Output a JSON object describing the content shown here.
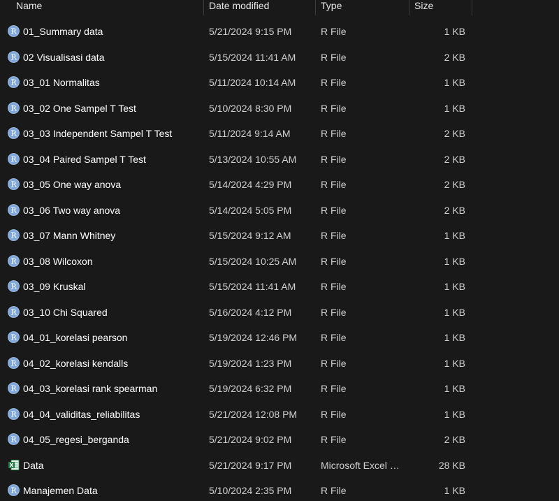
{
  "columns": {
    "name": "Name",
    "date": "Date modified",
    "type": "Type",
    "size": "Size"
  },
  "files": [
    {
      "icon": "r-file-icon",
      "name": "01_Summary data",
      "date": "5/21/2024 9:15 PM",
      "type": "R File",
      "size": "1 KB"
    },
    {
      "icon": "r-file-icon",
      "name": "02 Visualisasi data",
      "date": "5/15/2024 11:41 AM",
      "type": "R File",
      "size": "2 KB"
    },
    {
      "icon": "r-file-icon",
      "name": "03_01 Normalitas",
      "date": "5/11/2024 10:14 AM",
      "type": "R File",
      "size": "1 KB"
    },
    {
      "icon": "r-file-icon",
      "name": "03_02 One Sampel T Test",
      "date": "5/10/2024 8:30 PM",
      "type": "R File",
      "size": "1 KB"
    },
    {
      "icon": "r-file-icon",
      "name": "03_03 Independent Sampel T Test",
      "date": "5/11/2024 9:14 AM",
      "type": "R File",
      "size": "2 KB"
    },
    {
      "icon": "r-file-icon",
      "name": "03_04 Paired Sampel T Test",
      "date": "5/13/2024 10:55 AM",
      "type": "R File",
      "size": "2 KB"
    },
    {
      "icon": "r-file-icon",
      "name": "03_05 One way anova",
      "date": "5/14/2024 4:29 PM",
      "type": "R File",
      "size": "2 KB"
    },
    {
      "icon": "r-file-icon",
      "name": "03_06 Two way anova",
      "date": "5/14/2024 5:05 PM",
      "type": "R File",
      "size": "2 KB"
    },
    {
      "icon": "r-file-icon",
      "name": "03_07 Mann Whitney",
      "date": "5/15/2024 9:12 AM",
      "type": "R File",
      "size": "1 KB"
    },
    {
      "icon": "r-file-icon",
      "name": "03_08 Wilcoxon",
      "date": "5/15/2024 10:25 AM",
      "type": "R File",
      "size": "1 KB"
    },
    {
      "icon": "r-file-icon",
      "name": "03_09 Kruskal",
      "date": "5/15/2024 11:41 AM",
      "type": "R File",
      "size": "1 KB"
    },
    {
      "icon": "r-file-icon",
      "name": "03_10 Chi Squared",
      "date": "5/16/2024 4:12 PM",
      "type": "R File",
      "size": "1 KB"
    },
    {
      "icon": "r-file-icon",
      "name": "04_01_korelasi pearson",
      "date": "5/19/2024 12:46 PM",
      "type": "R File",
      "size": "1 KB"
    },
    {
      "icon": "r-file-icon",
      "name": "04_02_korelasi kendalls",
      "date": "5/19/2024 1:23 PM",
      "type": "R File",
      "size": "1 KB"
    },
    {
      "icon": "r-file-icon",
      "name": "04_03_korelasi rank spearman",
      "date": "5/19/2024 6:32 PM",
      "type": "R File",
      "size": "1 KB"
    },
    {
      "icon": "r-file-icon",
      "name": "04_04_validitas_reliabilitas",
      "date": "5/21/2024 12:08 PM",
      "type": "R File",
      "size": "1 KB"
    },
    {
      "icon": "r-file-icon",
      "name": "04_05_regesi_berganda",
      "date": "5/21/2024 9:02 PM",
      "type": "R File",
      "size": "2 KB"
    },
    {
      "icon": "excel-file-icon",
      "name": "Data",
      "date": "5/21/2024 9:17 PM",
      "type": "Microsoft Excel W...",
      "size": "28 KB"
    },
    {
      "icon": "r-file-icon",
      "name": "Manajemen Data",
      "date": "5/10/2024 2:35 PM",
      "type": "R File",
      "size": "1 KB"
    }
  ],
  "colors": {
    "background": "#191919",
    "r_icon": "#7fa7d9",
    "excel_icon": "#1f7a44"
  }
}
